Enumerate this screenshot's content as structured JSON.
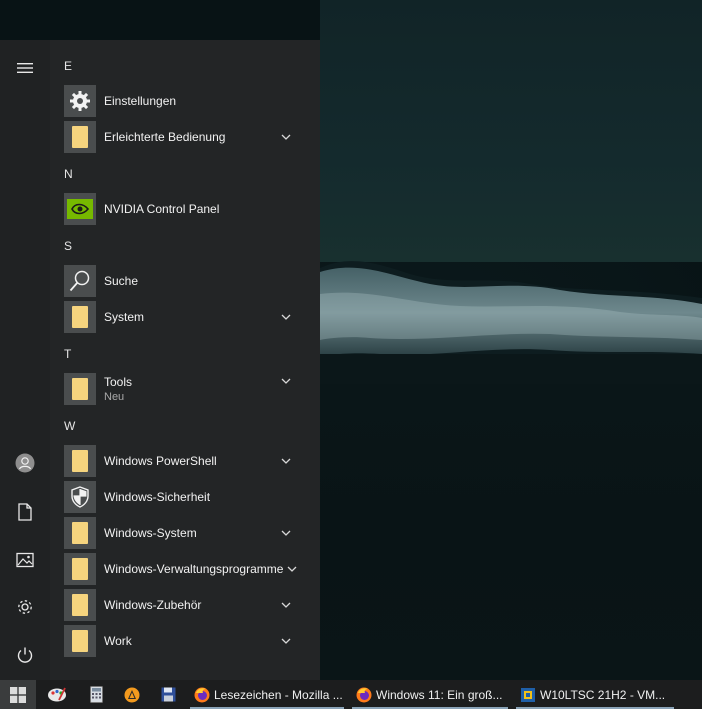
{
  "start_menu": {
    "groups": [
      {
        "letter": "E",
        "items": [
          {
            "label": "Einstellungen",
            "icon": "gear-icon"
          },
          {
            "label": "Erleichterte Bedienung",
            "icon": "folder-icon",
            "expandable": true
          }
        ]
      },
      {
        "letter": "N",
        "items": [
          {
            "label": "NVIDIA Control Panel",
            "icon": "nvidia-icon"
          }
        ]
      },
      {
        "letter": "S",
        "items": [
          {
            "label": "Suche",
            "icon": "search-icon"
          },
          {
            "label": "System",
            "icon": "folder-icon",
            "expandable": true
          }
        ]
      },
      {
        "letter": "T",
        "items": [
          {
            "label": "Tools",
            "sub": "Neu",
            "icon": "folder-icon",
            "expandable": true
          }
        ]
      },
      {
        "letter": "W",
        "items": [
          {
            "label": "Windows PowerShell",
            "icon": "folder-icon",
            "expandable": true
          },
          {
            "label": "Windows-Sicherheit",
            "icon": "shield-icon"
          },
          {
            "label": "Windows-System",
            "icon": "folder-icon",
            "expandable": true
          },
          {
            "label": "Windows-Verwaltungsprogramme",
            "icon": "folder-icon",
            "expandable": true
          },
          {
            "label": "Windows-Zubehör",
            "icon": "folder-icon",
            "expandable": true
          },
          {
            "label": "Work",
            "icon": "folder-icon",
            "expandable": true
          }
        ]
      }
    ],
    "rail_icons": [
      "hamburger-icon",
      "user-avatar-icon",
      "documents-icon",
      "pictures-icon",
      "settings-icon",
      "power-icon"
    ]
  },
  "taskbar": {
    "pinned_icons": [
      "start-icon",
      "paint-icon",
      "calculator-icon",
      "vlc-icon",
      "floppy-icon"
    ],
    "apps": [
      {
        "label": "Lesezeichen - Mozilla ...",
        "icon": "firefox-icon"
      },
      {
        "label": "Windows 11: Ein groß...",
        "icon": "firefox-icon"
      },
      {
        "label": "W10LTSC 21H2 - VM...",
        "icon": "virtualbox-icon"
      }
    ]
  },
  "colors": {
    "menu_bg": "#232526",
    "folder": "#f6d47e",
    "nvidia_green": "#76b900",
    "taskbar_bg": "#1c1d1e"
  }
}
